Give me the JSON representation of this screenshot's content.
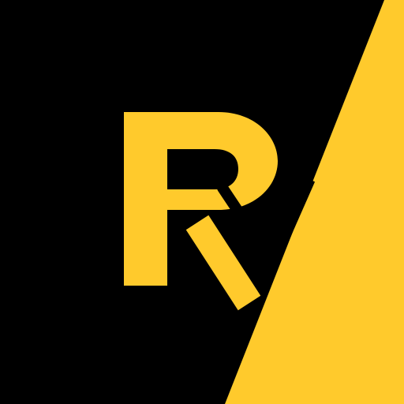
{
  "logo": {
    "letter": "R",
    "colors": {
      "background": "#000000",
      "accent": "#FFCA2C"
    }
  }
}
